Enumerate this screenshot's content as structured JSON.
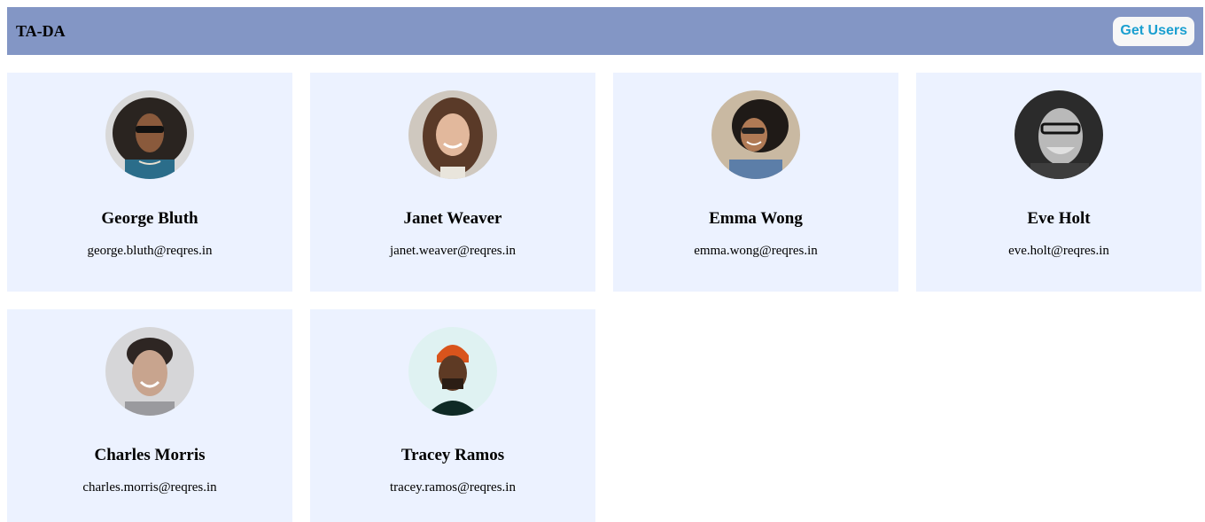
{
  "navbar": {
    "brand": "TA-DA",
    "get_users_label": "Get Users"
  },
  "users": [
    {
      "name": "George Bluth",
      "email": "george.bluth@reqres.in",
      "avatar": "george-avatar"
    },
    {
      "name": "Janet Weaver",
      "email": "janet.weaver@reqres.in",
      "avatar": "janet-avatar"
    },
    {
      "name": "Emma Wong",
      "email": "emma.wong@reqres.in",
      "avatar": "emma-avatar"
    },
    {
      "name": "Eve Holt",
      "email": "eve.holt@reqres.in",
      "avatar": "eve-avatar"
    },
    {
      "name": "Charles Morris",
      "email": "charles.morris@reqres.in",
      "avatar": "charles-avatar"
    },
    {
      "name": "Tracey Ramos",
      "email": "tracey.ramos@reqres.in",
      "avatar": "tracey-avatar"
    }
  ],
  "colors": {
    "navbar": "#8396c5",
    "card": "#ecf2ff",
    "button_text": "#1a9fd0"
  }
}
